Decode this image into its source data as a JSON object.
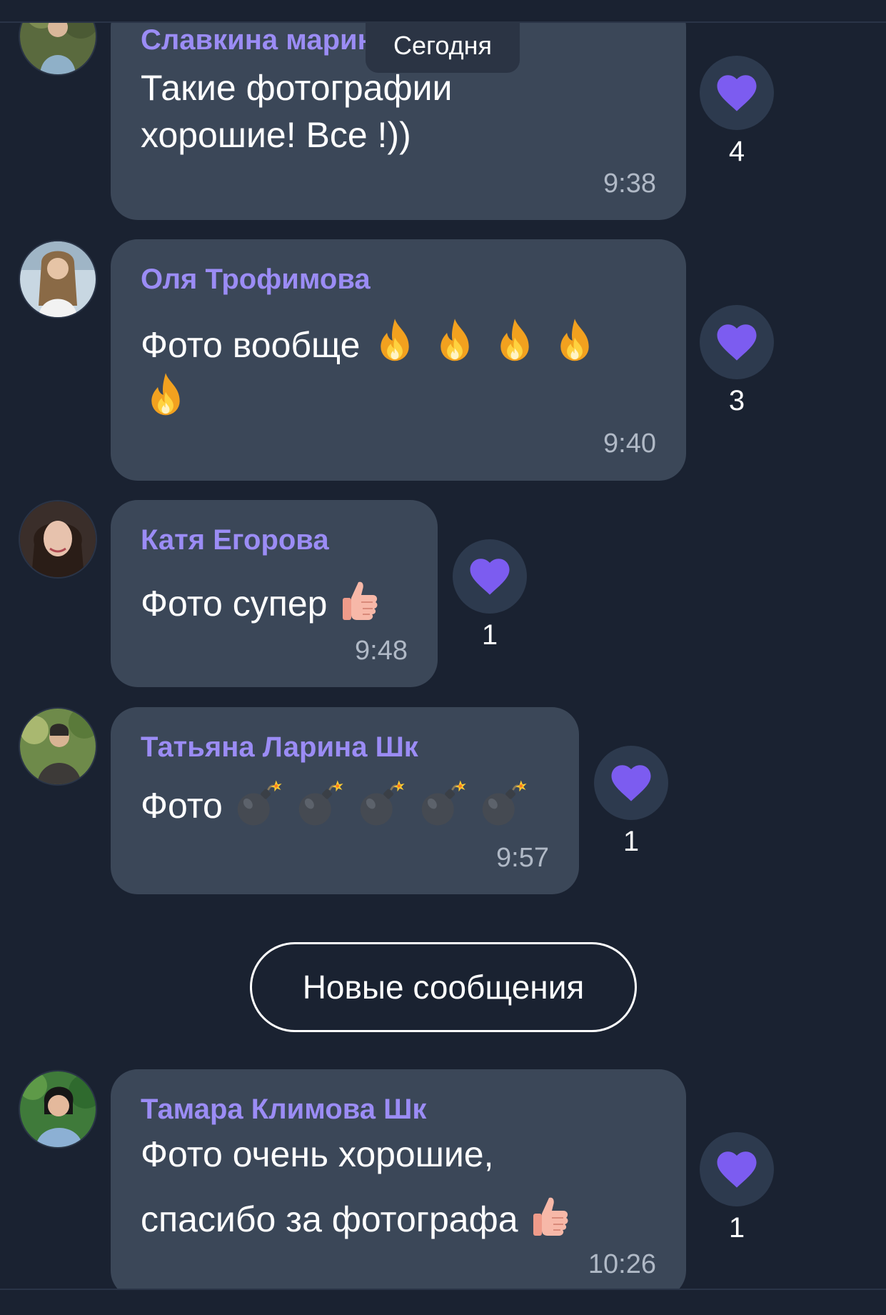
{
  "date_divider": "Сегодня",
  "new_messages_label": "Новые сообщения",
  "colors": {
    "background": "#1a2231",
    "bubble": "#3b4758",
    "sender": "#9b8cf5",
    "heart": "#7c5cf0",
    "heart_button": "#2d3a4e",
    "time": "#b0b9c6"
  },
  "messages": [
    {
      "sender": "Славкина марина",
      "lines": [
        "Такие фотографии",
        "хорошие! Все !))"
      ],
      "time": "9:38",
      "reaction": {
        "icon": "heart-icon",
        "count": "4"
      }
    },
    {
      "sender": "Оля Трофимова",
      "lines": [
        "Фото вообще"
      ],
      "emoji": "fire-emoji",
      "emoji_count": 5,
      "time": "9:40",
      "reaction": {
        "icon": "heart-icon",
        "count": "3"
      }
    },
    {
      "sender": "Катя Егорова",
      "lines": [
        "Фото супер"
      ],
      "emoji": "thumbs-up-emoji",
      "time": "9:48",
      "reaction": {
        "icon": "heart-icon",
        "count": "1"
      }
    },
    {
      "sender": "Татьяна Ларина Шк",
      "lines": [
        "Фото"
      ],
      "emoji": "bomb-emoji",
      "emoji_count": 5,
      "time": "9:57",
      "reaction": {
        "icon": "heart-icon",
        "count": "1"
      }
    },
    {
      "sender": "Тамара Климова Шк",
      "lines": [
        "Фото очень хорошие,",
        "спасибо за фотографа"
      ],
      "emoji": "thumbs-up-emoji",
      "time": "10:26",
      "reaction": {
        "icon": "heart-icon",
        "count": "1"
      }
    }
  ]
}
